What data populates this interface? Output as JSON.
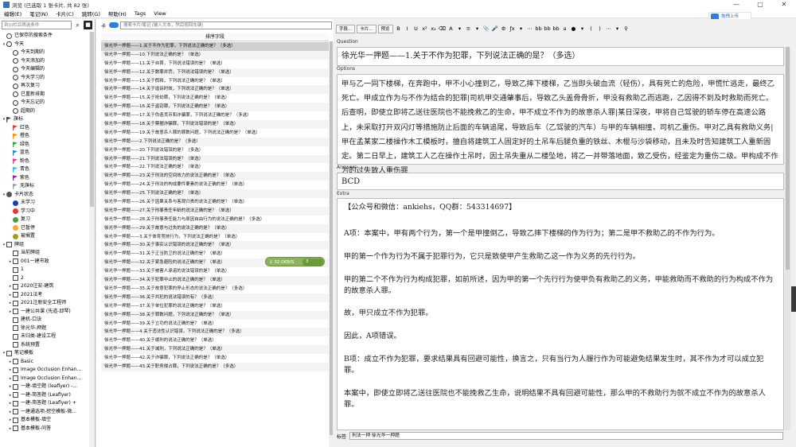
{
  "window": {
    "title": "浏览 (已选取 1 张卡片, 共 82 张)",
    "controls": [
      "—",
      "▢",
      "✕"
    ]
  },
  "menu": [
    "编辑(E)",
    "笔记(N)",
    "卡片(C)",
    "跳转(G)",
    "帮助(H)",
    "Tags",
    "View"
  ],
  "cloud_button": {
    "label": "拖拽上传"
  },
  "sidebar": {
    "search_placeholder": "到(i)栏目筛选条件",
    "tree": [
      {
        "label": "已保存的搜索条件",
        "icon": "star-icon",
        "arrow": "",
        "indent": 0
      },
      {
        "label": "今天",
        "icon": "clock-icon",
        "arrow": "▾",
        "indent": 0
      },
      {
        "label": "今天到期的",
        "icon": "clock-icon",
        "arrow": "",
        "indent": 1
      },
      {
        "label": "今天添加的",
        "icon": "clock-icon",
        "arrow": "",
        "indent": 1
      },
      {
        "label": "今天编辑的",
        "icon": "clock-icon",
        "arrow": "",
        "indent": 1
      },
      {
        "label": "今天学习的",
        "icon": "clock-icon",
        "arrow": "",
        "indent": 1
      },
      {
        "label": "再次复习",
        "icon": "clock-icon",
        "arrow": "",
        "indent": 1
      },
      {
        "label": "已重新排期",
        "icon": "clock-icon",
        "arrow": "",
        "indent": 1
      },
      {
        "label": "今天忘记的",
        "icon": "clock-icon",
        "arrow": "",
        "indent": 1
      },
      {
        "label": "超期的",
        "icon": "clock-icon",
        "arrow": "",
        "indent": 1
      },
      {
        "label": "旗标",
        "icon": "flag-icon",
        "arrow": "▾",
        "indent": 0,
        "color": "#444444"
      },
      {
        "label": "红色",
        "icon": "flag-icon",
        "arrow": "",
        "indent": 1,
        "color": "#e53935"
      },
      {
        "label": "橙色",
        "icon": "flag-icon",
        "arrow": "",
        "indent": 1,
        "color": "#fb8c00"
      },
      {
        "label": "绿色",
        "icon": "flag-icon",
        "arrow": "",
        "indent": 1,
        "color": "#43a047"
      },
      {
        "label": "蓝色",
        "icon": "flag-icon",
        "arrow": "",
        "indent": 1,
        "color": "#1e88e5"
      },
      {
        "label": "粉色",
        "icon": "flag-icon",
        "arrow": "",
        "indent": 1,
        "color": "#ec407a"
      },
      {
        "label": "青色",
        "icon": "flag-icon",
        "arrow": "",
        "indent": 1,
        "color": "#26c6da"
      },
      {
        "label": "紫色",
        "icon": "flag-icon",
        "arrow": "",
        "indent": 1,
        "color": "#8e24aa"
      },
      {
        "label": "无旗标",
        "icon": "flag-icon",
        "arrow": "",
        "indent": 1,
        "color": "#9e9e9e"
      },
      {
        "label": "卡片状态",
        "icon": "state-icon",
        "arrow": "▾",
        "indent": 0,
        "color": "#555555"
      },
      {
        "label": "未学习",
        "icon": "circle-icon",
        "arrow": "",
        "indent": 1,
        "color": "#1e40af"
      },
      {
        "label": "学习中",
        "icon": "circle-icon",
        "arrow": "",
        "indent": 1,
        "color": "#e53935"
      },
      {
        "label": "复习",
        "icon": "circle-icon",
        "arrow": "",
        "indent": 1,
        "color": "#43a047"
      },
      {
        "label": "已暂停",
        "icon": "circle-icon",
        "arrow": "",
        "indent": 1,
        "color": "#f9a825"
      },
      {
        "label": "被搁置",
        "icon": "circle-icon",
        "arrow": "",
        "indent": 1,
        "color": "#9e9e24"
      },
      {
        "label": "牌组",
        "icon": "deck-icon",
        "arrow": "▾",
        "indent": 0
      },
      {
        "label": "当前牌组",
        "icon": "deck-icon",
        "arrow": "",
        "indent": 1
      },
      {
        "label": "001一建市政",
        "icon": "deck-icon",
        "arrow": "▸",
        "indent": 1
      },
      {
        "label": "1",
        "icon": "deck-icon",
        "arrow": "",
        "indent": 1
      },
      {
        "label": "2",
        "icon": "deck-icon",
        "arrow": "",
        "indent": 1
      },
      {
        "label": "2020注安-建筑",
        "icon": "deck-icon",
        "arrow": "▸",
        "indent": 1
      },
      {
        "label": "2021法考",
        "icon": "deck-icon",
        "arrow": "▸",
        "indent": 1
      },
      {
        "label": "2021注册安全工程师",
        "icon": "deck-icon",
        "arrow": "▸",
        "indent": 1
      },
      {
        "label": "一建公共课 (先道-邱琴)",
        "icon": "deck-icon",
        "arrow": "▸",
        "indent": 1
      },
      {
        "label": "建机-口诀",
        "icon": "deck-icon",
        "arrow": "",
        "indent": 1
      },
      {
        "label": "徐光华-押题",
        "icon": "deck-icon",
        "arrow": "",
        "indent": 1
      },
      {
        "label": "未归类-建设工程",
        "icon": "deck-icon",
        "arrow": "",
        "indent": 1
      },
      {
        "label": "系统预置",
        "icon": "deck-icon",
        "arrow": "",
        "indent": 1
      },
      {
        "label": "笔记模板",
        "icon": "note-icon",
        "arrow": "▾",
        "indent": 0
      },
      {
        "label": "Basic",
        "icon": "note-icon",
        "arrow": "▸",
        "indent": 1
      },
      {
        "label": "Image Occlusion Enhan...",
        "icon": "note-icon",
        "arrow": "▸",
        "indent": 1
      },
      {
        "label": "Image Occlusion Enhan...",
        "icon": "note-icon",
        "arrow": "▸",
        "indent": 1
      },
      {
        "label": "一建-填空题 (leaflyer) -...",
        "icon": "note-icon",
        "arrow": "▸",
        "indent": 1
      },
      {
        "label": "一建-简答题 (Leaflyer)",
        "icon": "note-icon",
        "arrow": "▸",
        "indent": 1
      },
      {
        "label": "一建-简答题 (Leaflyer) +",
        "icon": "note-icon",
        "arrow": "▸",
        "indent": 1
      },
      {
        "label": "一建通选项-挖空模板-微...",
        "icon": "note-icon",
        "arrow": "▸",
        "indent": 1
      },
      {
        "label": "基本模板-填空",
        "icon": "note-icon",
        "arrow": "▸",
        "indent": 1
      },
      {
        "label": "基本模板-问答",
        "icon": "note-icon",
        "arrow": "▸",
        "indent": 1
      }
    ]
  },
  "middle": {
    "toggle_label": "卡",
    "search_placeholder": "搜索卡片/笔记 (输入文本，然后按回车键)",
    "column_header": "排序字段",
    "rows": [
      "徐光华一押题——1.关于不作为犯罪，下列说法正确的是？（多选）",
      "徐光华一押题——10.下列说法正确的是？（单选）",
      "徐光华一押题——11.关于自首，下列说法错误的是？（单选）",
      "徐光华一押题——12.关于数罪并罚，下列说法错误的是？（单选）",
      "徐光华一押题——13.关于假释，下列说法正确的是？（单选）",
      "徐光华一押题——14.关于追诉时效，下列说法正确的是？（单选）",
      "徐光华一押题——15.关于抢劫罪，下列说法正确的是？（单选）",
      "徐光华一押题——16.关于盗窃罪，下列说法正确的是？（单选）",
      "徐光华一押题——17.关于伪造货币和诈骗罪，下列说法正确的是？（多选）",
      "徐光华一押题——18.关于票据诈骗罪，下列说法错误的是？（单选）",
      "徐光华一押题——19.关于故意杀人罪的罪数问题，下列说法正确的是？（单选）",
      "徐光华一押题——2.下列说法正确的是？（多选）",
      "徐光华一押题——20.下列说法错误的是？（多选）",
      "徐光华一押题——21.下列说法错误的是？（单选）",
      "徐光华一押题——22.下列说法正确的是？（单选）",
      "徐光华一押题——23.关于刑法的空间效力的说法正确的是？（单选）",
      "徐光华一押题——24.关于刑法的构成要件要素的说法正确的是？（单选）",
      "徐光华一押题——25.下列说法正确的是？（单选）",
      "徐光华一押题——26.关于因果关系与客观归责的说法正确的是？（单选）",
      "徐光华一押题——27.关于刑事责任年龄的说法正确的是？（单选）",
      "徐光华一押题——28.关于刑事责任能力与原因自由行为的说法正确的是？（多选）",
      "徐光华一押题——29.关于故意与过失的说法正确的是？（单选）",
      "徐光华一押题——3.关于体育竞技行为，下列说法正确的是？（单选）",
      "徐光华一押题——30.关于事实认识错误的说法正确的是？（单选）",
      "徐光华一押题——31.关于正当防卫的说法正确的是？（单选）",
      "徐光华一押题——32.关于紧急避险的说法正确的是？（单选）",
      "徐光华一押题——33.关于被害人承诺的说法错误的是？（单选）",
      "徐光华一押题——34.关于犯罪中止的说法正确的是？（单选）",
      "徐光华一押题——35.关于故意犯罪的停止形态的说法正确的是？（多选）",
      "徐光华一押题——36.关于共犯的说法错误的有？（多选）",
      "徐光华一押题——37.关于单位犯罪的说法正确的是？（单选）",
      "徐光华一押题——38.关于罪数问题，下列说法正确的是？（单选）",
      "徐光华一押题——39.关于立功的说法正确的是？（单选）",
      "徐光华一押题——4.关于违法性认识错误，下列说法正确的是？（多选）",
      "徐光华一押题——40.关于缓刑的说法正确的是？（单选）",
      "徐光华一押题——41.关于减刑，下列说法正确的是？（单选）",
      "徐光华一押题——42.关于诈骗罪，下列说法正确的是？（单选）",
      "徐光华一押题——43.关于职务侵占罪，下列说法正确的是？（多选）"
    ]
  },
  "editor": {
    "toolbar": {
      "fields_btn": "字段...",
      "cards_btn": "卡片...",
      "preview_btn": "预览",
      "icons": [
        "B",
        "I",
        "U",
        "x²",
        "x₂",
        "⌫",
        "A",
        "▾",
        "≡",
        "▾",
        "📎",
        "🎤",
        "⚙",
        "ƒx",
        "▾",
        "⋯",
        "bb",
        "bb",
        "bb",
        "a",
        "●",
        "▾",
        "(",
        ")",
        "⋯",
        "▾",
        "⚲"
      ]
    },
    "labels": {
      "question": "Question",
      "options": "Options",
      "answers": "Answers",
      "extra": "Extra",
      "tags": "标签"
    },
    "question": "徐光华一押题——1.关于不作为犯罪，下列说法正确的是？（多选）",
    "options": "甲与乙一同下楼梯，在奔跑中，甲不小心撞到乙，导致乙摔下楼梯，乙当即头破血流（轻伤），具有死亡的危险，甲慌忙逃走，最终乙死亡。甲成立作为与不作为结合的犯罪|司机甲交通肇事后，导致乙头盖骨骨折，甲没有救助乙而逃跑，乙因得不到及时救助而死亡。后查明，即使立即将乙送往医院也不能挽救乙的生命，甲不成立不作为的故意杀人罪|某日深夜，甲将自己驾驶的轿车停在高速公路上，未采取打开双闪灯等措施防止后面的车辆追尾，导致后车（乙驾驶的汽车）与甲的车辆相撞，司机乙重伤。甲对乙具有救助义务|甲在孟某家二楼操作木工模板时，擅自将建筑工人固定好的土吊车后腿负重的铁丝、木棍与沙袋移动，且未及时告知建筑工人重新固定。第二日早上，建筑工人乙在操作土吊时，因土吊失重从二楼坠地，将乙一并带落地面，致乙受伤，经鉴定为重伤二级。甲构成不作为的过失致人重伤罪",
    "answers": "BCD",
    "extra": {
      "contact": "【公众号和微信：ankiehs，QQ群：543314697】",
      "paragraphs": [
        "A项：本案中，甲有两个行为，第一个是甲撞倒乙，导致乙摔下楼梯的作为行为；第二是甲不救助乙的不作为行为。",
        "甲的第一个作为行为不属于犯罪行为，它只是致使甲产生救助乙这一作为义务的先行行为。",
        "甲的第二个不作为行为构成犯罪，如前所述，因为甲的第一个先行行为使甲负有救助乙的义务，甲能救助而不救助的行为构成不作为的故意杀人罪。",
        "故，甲只成立不作为犯罪。",
        "因此，A项错误。",
        "B项：成立不作为犯罪，要求结果具有回避可能性，换言之，只有当行为人履行作为可能避免结果发生时，其不作为才可以成立犯罪。",
        "本案中，即使立即将乙送往医院也不能挽救乙生命，说明结果不具有回避可能性，那么甲的不救助行为就不成立不作为的故意杀人罪。"
      ]
    },
    "tags_value": "刑法一押 徐光华一押题"
  },
  "net_badge": {
    "down": "↓ 32.0KB/S",
    "up": "3"
  }
}
